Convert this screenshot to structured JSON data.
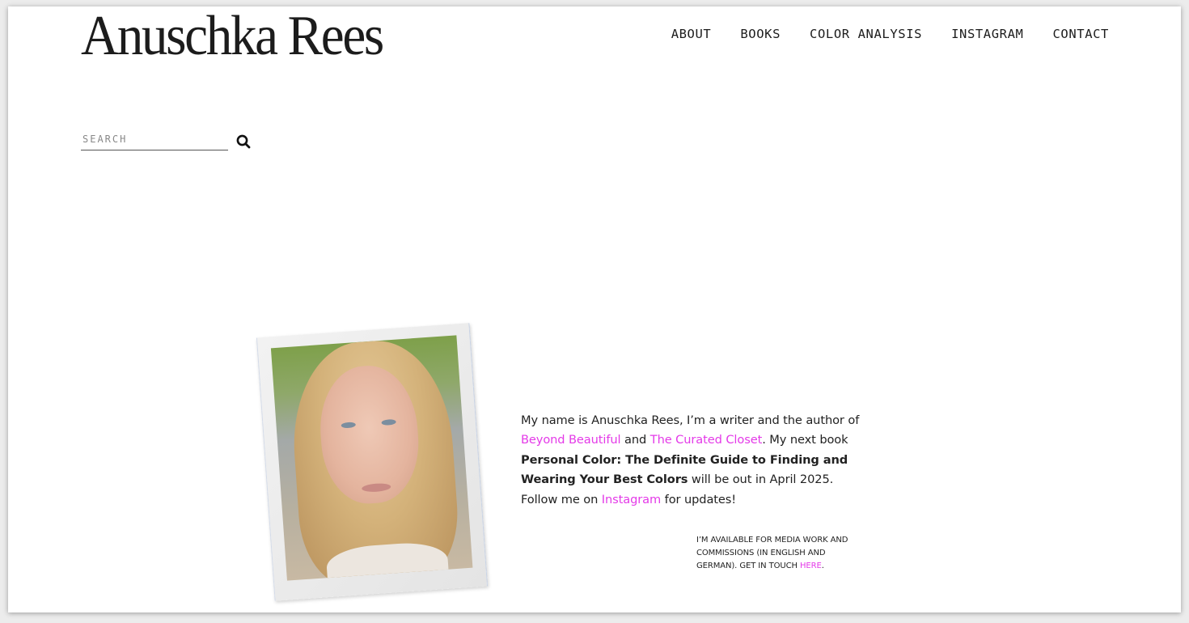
{
  "site": {
    "title": "Anuschka Rees"
  },
  "nav": {
    "items": [
      {
        "label": "ABOUT"
      },
      {
        "label": "BOOKS"
      },
      {
        "label": "COLOR ANALYSIS"
      },
      {
        "label": "INSTAGRAM"
      },
      {
        "label": "CONTACT"
      }
    ]
  },
  "search": {
    "placeholder": "SEARCH",
    "value": "",
    "icon": "search-icon"
  },
  "photo": {
    "alt": "Portrait photo of Anuschka Rees in a polaroid frame"
  },
  "bio": {
    "intro": "My name is Anuschka Rees, I’m a writer and the author of ",
    "link_book1": "Beyond Beautiful",
    "and": " and ",
    "link_book2": "The Curated Closet",
    "next": ". My next book ",
    "next_book_title": "Personal Color: The Definite Guide to Finding and Wearing Your Best Colors",
    "release": " will be out in April 2025. Follow me on ",
    "link_instagram": "Instagram",
    "outro": " for updates!"
  },
  "media": {
    "text": "I’M AVAILABLE FOR MEDIA WORK AND COMMISSIONS (IN ENGLISH AND GERMAN). GET IN TOUCH ",
    "link": "HERE",
    "end": "."
  },
  "colors": {
    "link": "#e43ae8",
    "text": "#222222",
    "background": "#ffffff"
  }
}
